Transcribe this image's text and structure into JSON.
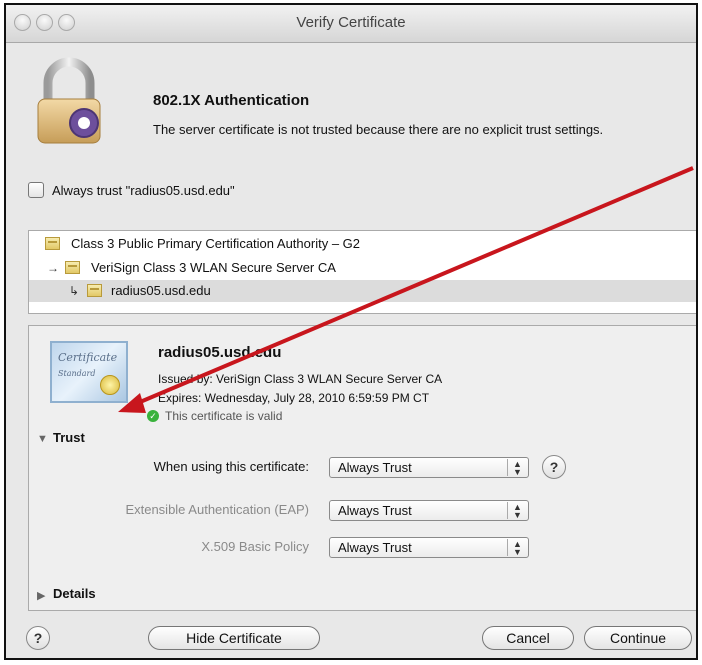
{
  "window": {
    "title": "Verify Certificate"
  },
  "header": {
    "title": "802.1X Authentication",
    "message": "The server certificate is not trusted because there are no explicit trust settings."
  },
  "always_trust": {
    "label": "Always trust \"radius05.usd.edu\"",
    "checked": false
  },
  "chain": [
    {
      "label": "Class 3 Public Primary Certification Authority – G2",
      "level": 0,
      "selected": false
    },
    {
      "label": "VeriSign Class 3 WLAN Secure Server CA",
      "level": 1,
      "selected": false
    },
    {
      "label": "radius05.usd.edu",
      "level": 2,
      "selected": true
    }
  ],
  "certificate": {
    "badge_text": "Certificate",
    "badge_sub": "Standard",
    "name": "radius05.usd.edu",
    "issued_by": "Issued by: VeriSign Class 3 WLAN Secure Server CA",
    "expires": "Expires: Wednesday, July 28, 2010 6:59:59 PM CT",
    "status": "This certificate is valid"
  },
  "trust": {
    "section_label": "Trust",
    "expanded": true,
    "rows": [
      {
        "label": "When using this certificate:",
        "value": "Always Trust"
      },
      {
        "label": "Extensible Authentication (EAP)",
        "value": "Always Trust"
      },
      {
        "label": "X.509 Basic Policy",
        "value": "Always Trust"
      }
    ]
  },
  "details": {
    "section_label": "Details",
    "expanded": false
  },
  "buttons": {
    "help": "?",
    "hide_certificate": "Hide Certificate",
    "cancel": "Cancel",
    "continue": "Continue"
  },
  "colors": {
    "annotation_arrow": "#c8161d",
    "valid_icon": "#39b23c"
  },
  "icons": {
    "lock": "padlock-icon",
    "cert": "certificate-icon",
    "disclosure_open": "▼",
    "disclosure_closed": "▶",
    "child_arrow": "→",
    "leaf_arrow": "↳",
    "check": "✓"
  }
}
